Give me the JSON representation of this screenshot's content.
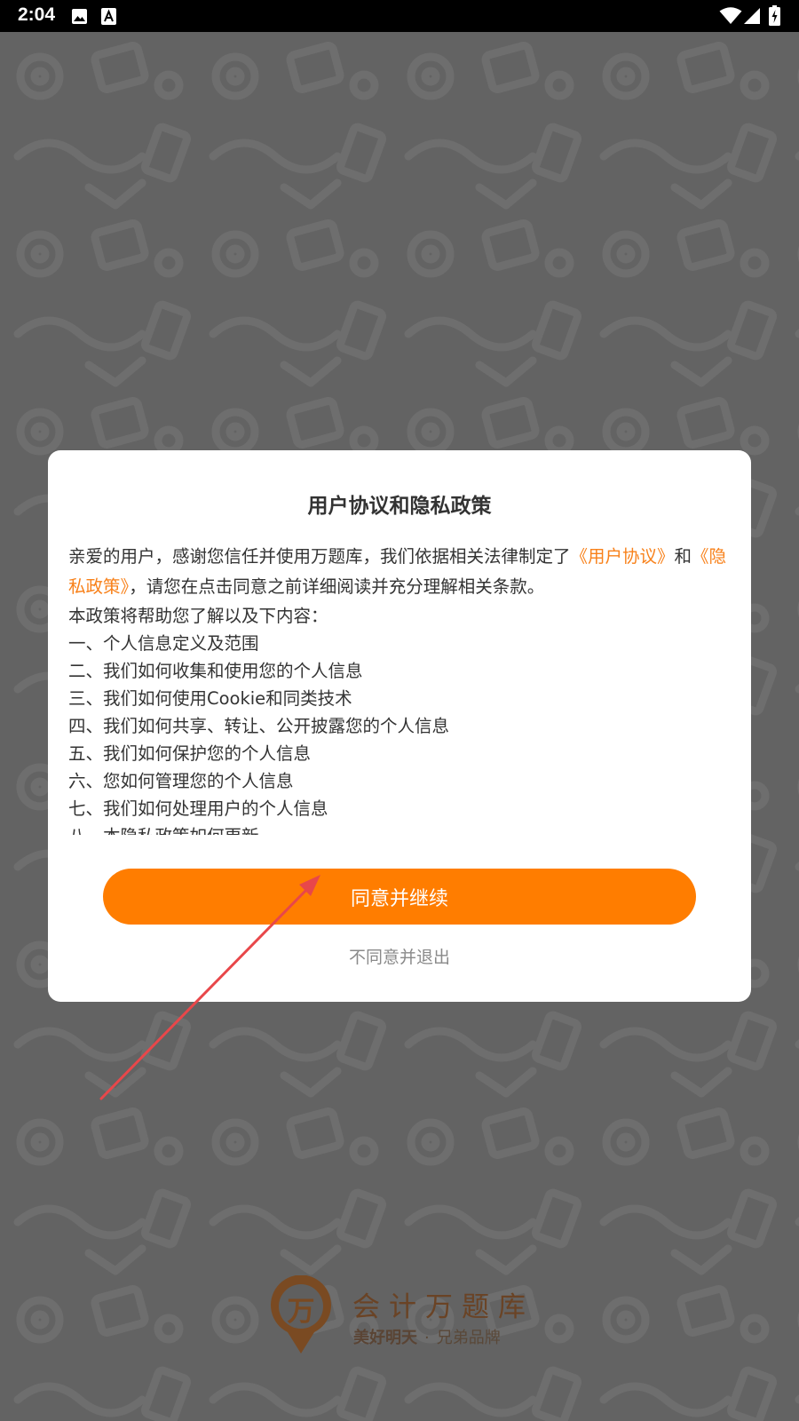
{
  "status_bar": {
    "time": "2:04",
    "icons": [
      "image-icon",
      "font-a-icon",
      "wifi-icon",
      "signal-icon",
      "battery-charging-icon"
    ]
  },
  "dialog": {
    "title": "用户协议和隐私政策",
    "intro_prefix": "亲爱的用户，感谢您信任并使用万题库，我们依据相关法律制定了",
    "user_agreement_link": "《用户协议》",
    "intro_and": "和",
    "privacy_policy_link": "《隐私政策》",
    "intro_suffix": "，请您在点击同意之前详细阅读并充分理解相关条款。",
    "lead": "本政策将帮助您了解以及下内容：",
    "items": [
      "一、个人信息定义及范围",
      "二、我们如何收集和使用您的个人信息",
      "三、我们如何使用Cookie和同类技术",
      "四、我们如何共享、转让、公开披露您的个人信息",
      "五、我们如何保护您的个人信息",
      "六、您如何管理您的个人信息",
      "七、我们如何处理用户的个人信息",
      "八、本隐私政策如何更新"
    ],
    "agree_button": "同意并继续",
    "disagree_link": "不同意并退出"
  },
  "brand": {
    "logo_char": "万",
    "name": "会计万题库",
    "slogan_bold": "美好明天",
    "slogan_dot": "·",
    "slogan_rest": "兄弟品牌"
  },
  "colors": {
    "accent": "#ff7d00",
    "link": "#f8811a",
    "overlay_bg": "#636363",
    "annotation_arrow": "#e8474a",
    "brand": "#7a4a22"
  }
}
